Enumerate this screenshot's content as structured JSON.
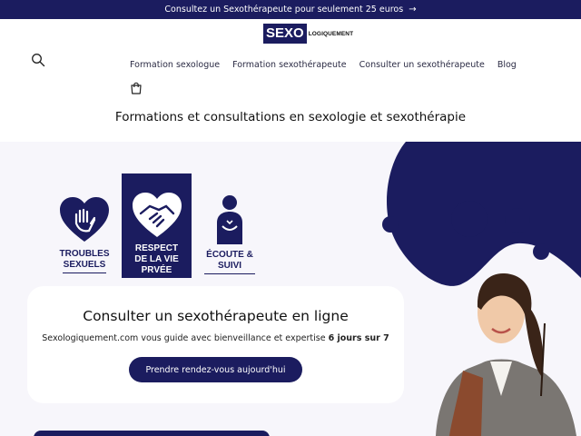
{
  "announcement": {
    "text": "Consultez un Sexothérapeute pour seulement 25 euros",
    "arrow": "→"
  },
  "logo": {
    "box": "SEXO",
    "rest": "LOGIQUEMENT"
  },
  "nav": {
    "items": [
      "Formation sexologue",
      "Formation sexothérapeute",
      "Consulter un sexothérapeute",
      "Blog"
    ]
  },
  "tagline": "Formations et consultations en sexologie et sexothérapie",
  "features": [
    {
      "line1": "TROUBLES",
      "line2": "SEXUELS",
      "line3": ""
    },
    {
      "line1": "RESPECT",
      "line2": "DE LA VIE",
      "line3": "PRVÉE"
    },
    {
      "line1": "ÉCOUTE &",
      "line2": "SUIVI",
      "line3": ""
    }
  ],
  "hero": {
    "title": "Consulter un sexothérapeute en ligne",
    "subtitle": "Sexologiquement.com vous guide avec bienveillance et expertise",
    "subtitle_bold": "6 jours sur 7",
    "cta": "Prendre rendez-vous aujourd'hui"
  },
  "colors": {
    "brand": "#1b1c5f",
    "background": "#f7f6fb"
  },
  "icons": [
    "search-icon",
    "cart-icon",
    "arrow-right-icon",
    "heart-hand-icon",
    "heart-handshake-icon",
    "person-icon"
  ]
}
